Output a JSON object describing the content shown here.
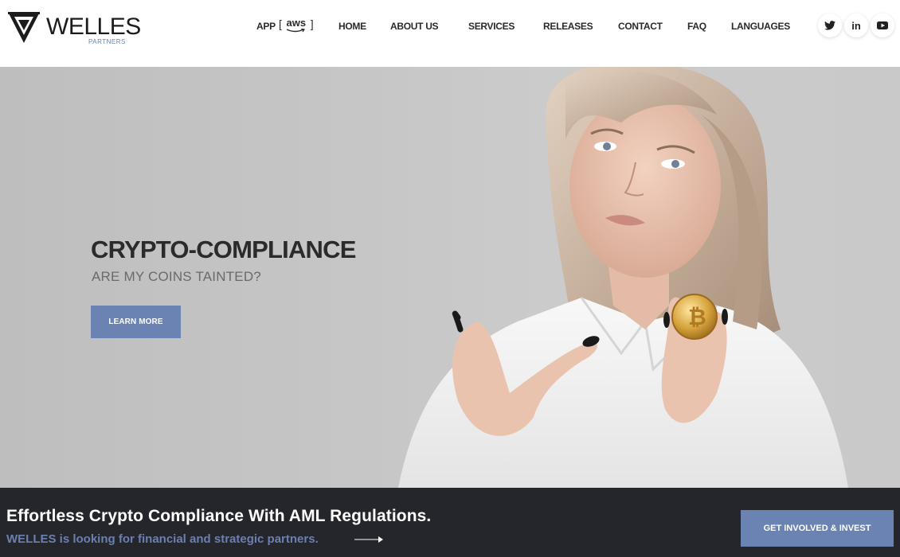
{
  "brand": {
    "name": "WELLES",
    "sub": "PARTNERS"
  },
  "nav": {
    "app_label": "APP",
    "aws_open": "[",
    "aws_text": "aws",
    "aws_close": "]",
    "items": [
      "HOME",
      "ABOUT US",
      "SERVICES",
      "RELEASES",
      "CONTACT",
      "FAQ",
      "LANGUAGES"
    ]
  },
  "social": {
    "items": [
      "twitter-icon",
      "linkedin-icon",
      "youtube-icon"
    ],
    "linkedin_text": "in"
  },
  "hero": {
    "title": "CRYPTO-COMPLIANCE",
    "subtitle": "ARE MY COINS TAINTED?",
    "button": "LEARN MORE"
  },
  "band": {
    "title": "Effortless Crypto Compliance With AML Regulations.",
    "subtitle": "WELLES is looking for financial and strategic partners.",
    "button": "GET INVOLVED & INVEST"
  },
  "colors": {
    "accent": "#6b83b3",
    "dark": "#25262c",
    "text": "#2b2b2b"
  }
}
